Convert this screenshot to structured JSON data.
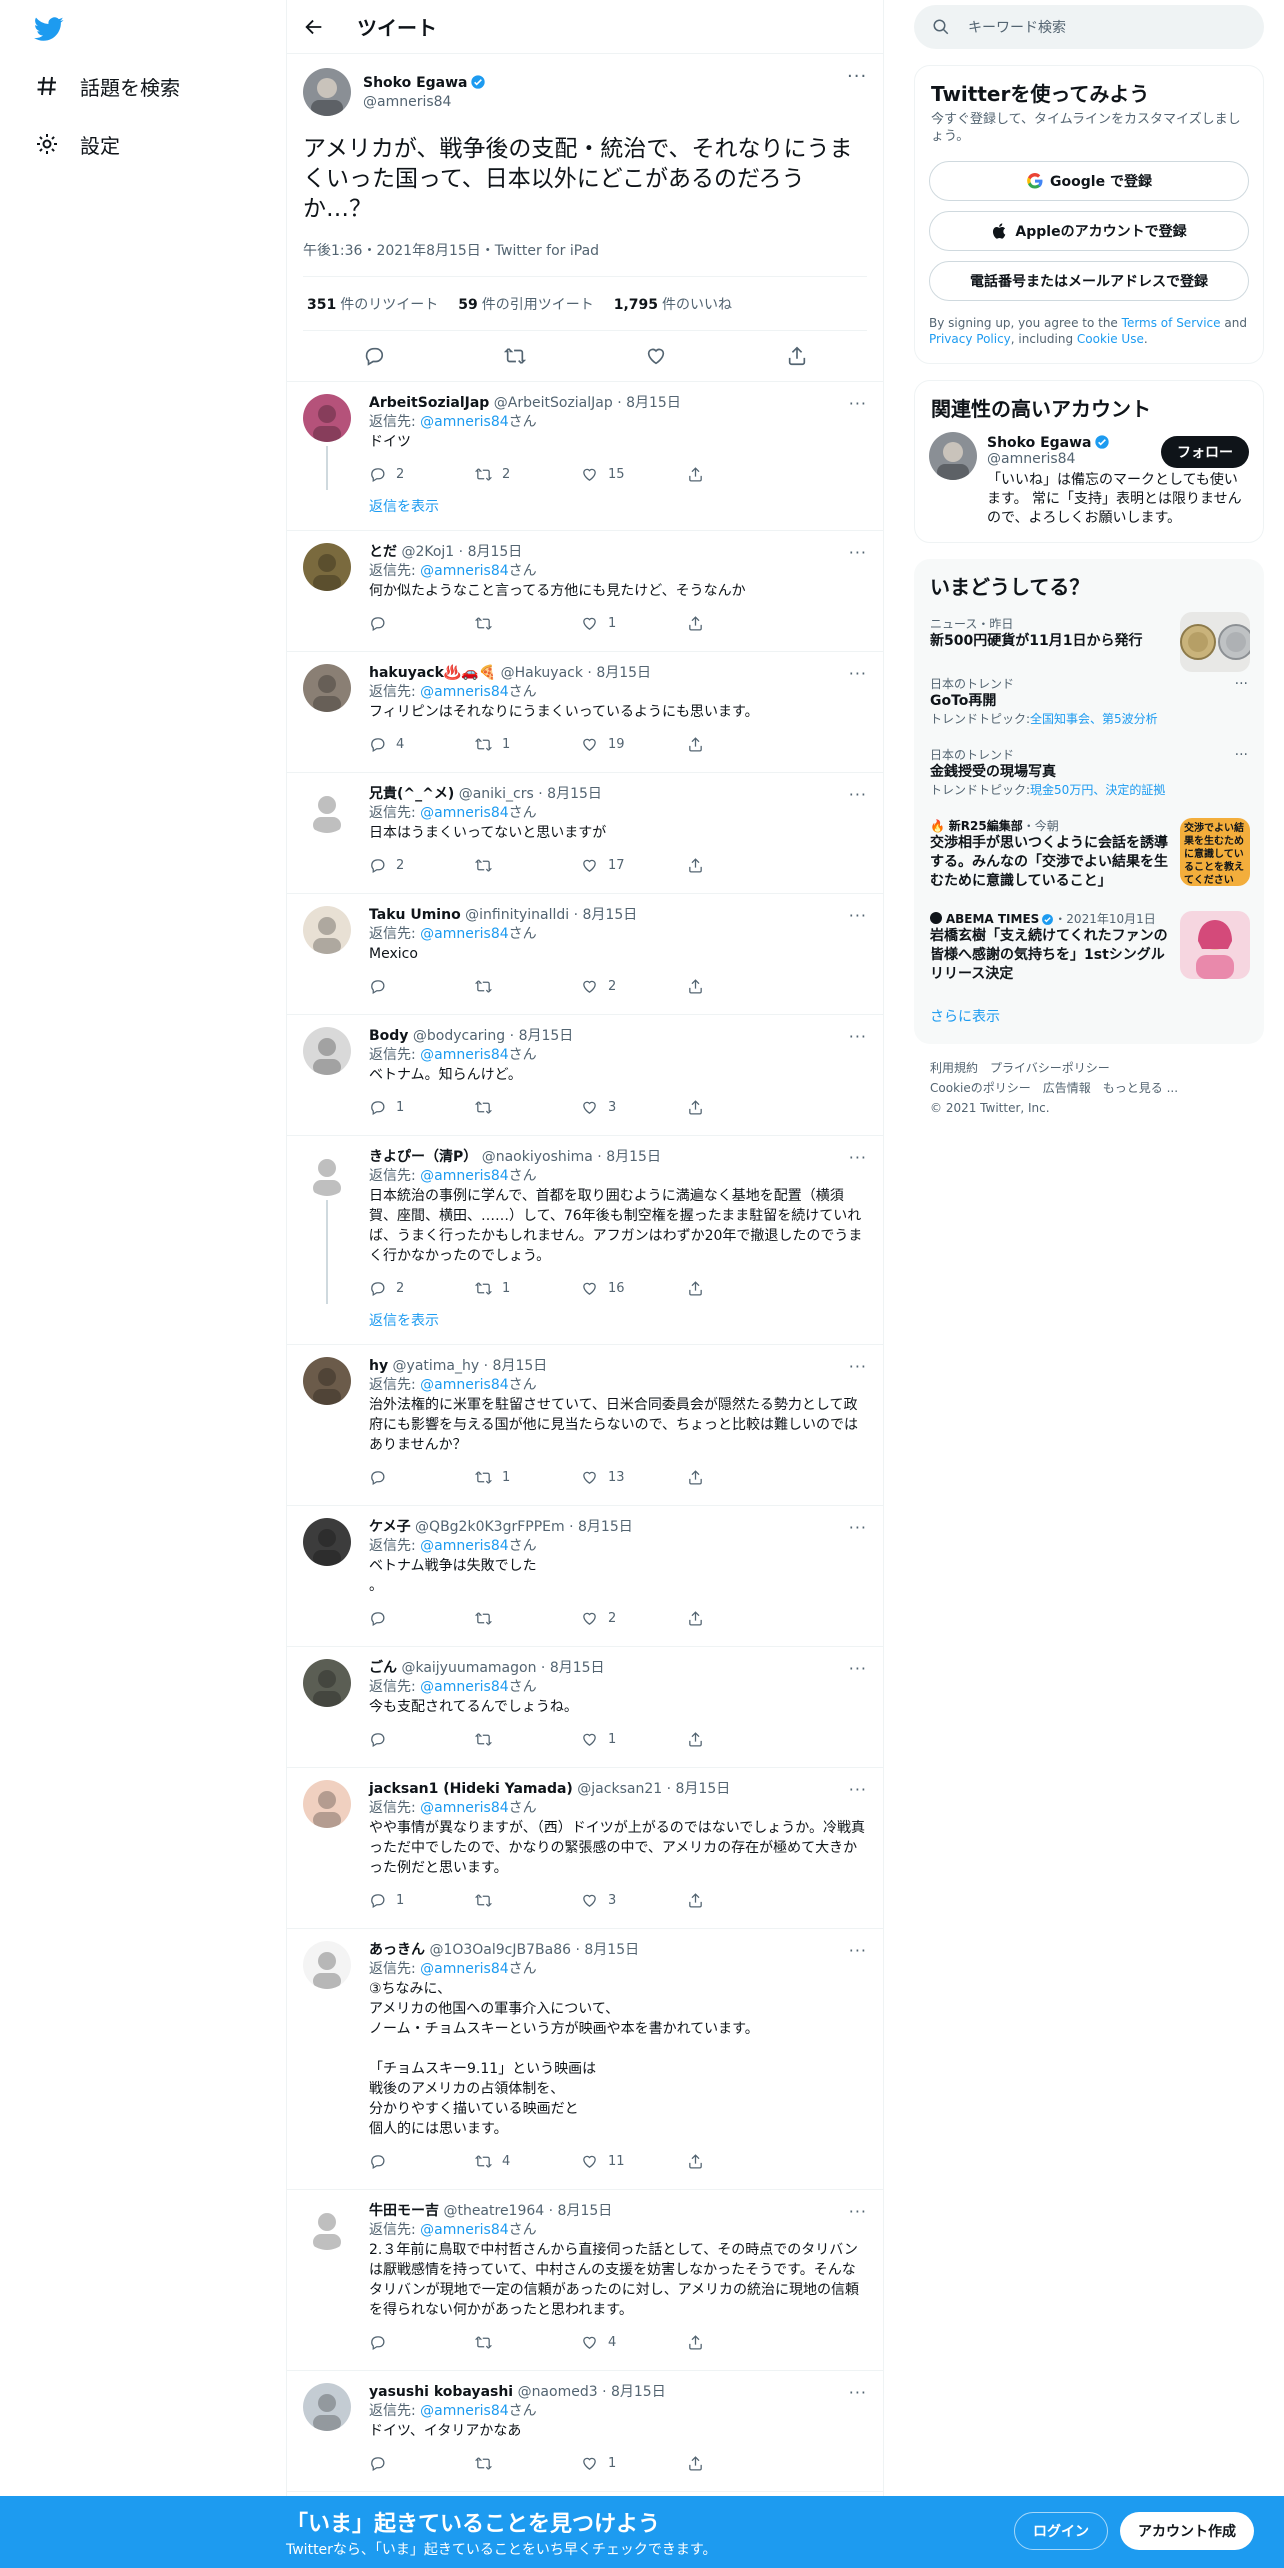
{
  "nav": {
    "explore_label": "話題を検索",
    "settings_label": "設定"
  },
  "header": {
    "title": "ツイート"
  },
  "main_tweet": {
    "display_name": "Shoko Egawa",
    "username": "@amneris84",
    "text": "アメリカが、戦争後の支配・統治で、それなりにうまくいった国って、日本以外にどこがあるのだろうか…？",
    "meta": "午後1:36・2021年8月15日・Twitter for iPad",
    "retweets_count": "351",
    "retweets_label": "件のリツイート",
    "quotes_count": "59",
    "quotes_label": "件の引用ツイート",
    "likes_count": "1,795",
    "likes_label": "件のいいね"
  },
  "replies": [
    {
      "name": "ArbeitSozialJap",
      "handle": "@ArbeitSozialJap",
      "date": "8月15日",
      "to": "@amneris84",
      "text": "ドイツ",
      "reply": "2",
      "rt": "2",
      "like": "15",
      "show_replies": "返信を表示"
    },
    {
      "name": "とだ",
      "handle": "@2Koj1",
      "date": "8月15日",
      "to": "@amneris84",
      "text": "何か似たようなこと言ってる方他にも見たけど、そうなんか",
      "reply": "",
      "rt": "",
      "like": "1"
    },
    {
      "name": "hakuyack♨️🚗🍕",
      "handle": "@Hakuyack",
      "date": "8月15日",
      "to": "@amneris84",
      "text": "フィリピンはそれなりにうまくいっているようにも思います。",
      "reply": "4",
      "rt": "1",
      "like": "19"
    },
    {
      "name": "兄貴(^_^メ)",
      "handle": "@aniki_crs",
      "date": "8月15日",
      "to": "@amneris84",
      "text": "日本はうまくいってないと思いますが",
      "reply": "2",
      "rt": "",
      "like": "17"
    },
    {
      "name": "Taku Umino",
      "handle": "@infinityinalldi",
      "date": "8月15日",
      "to": "@amneris84",
      "text": "Mexico",
      "reply": "",
      "rt": "",
      "like": "2"
    },
    {
      "name": "Body",
      "handle": "@bodycaring",
      "date": "8月15日",
      "to": "@amneris84",
      "text": "ベトナム。知らんけど。",
      "reply": "1",
      "rt": "",
      "like": "3"
    },
    {
      "name": "きよぴー（清P）",
      "handle": "@naokiyoshima",
      "date": "8月15日",
      "to": "@amneris84",
      "text": "日本統治の事例に学んで、首都を取り囲むように満遍なく基地を配置（横須賀、座間、横田、……）して、76年後も制空権を握ったまま駐留を続けていれば、うまく行ったかもしれません。アフガンはわずか20年で撤退したのでうまく行かなかったのでしょう。",
      "reply": "2",
      "rt": "1",
      "like": "16",
      "show_replies": "返信を表示"
    },
    {
      "name": "hy",
      "handle": "@yatima_hy",
      "date": "8月15日",
      "to": "@amneris84",
      "text": "治外法権的に米軍を駐留させていて、日米合同委員会が隠然たる勢力として政府にも影響を与える国が他に見当たらないので、ちょっと比較は難しいのではありませんか？",
      "reply": "",
      "rt": "1",
      "like": "13"
    },
    {
      "name": "ケメ子",
      "handle": "@QBg2k0K3grFPPEm",
      "date": "8月15日",
      "to": "@amneris84",
      "text": "ベトナム戦争は失敗でした\n。",
      "reply": "",
      "rt": "",
      "like": "2"
    },
    {
      "name": "ごん",
      "handle": "@kaijyuumamagon",
      "date": "8月15日",
      "to": "@amneris84",
      "text": "今も支配されてるんでしょうね。",
      "reply": "",
      "rt": "",
      "like": "1"
    },
    {
      "name": "jacksan1 (Hideki Yamada)",
      "handle": "@jacksan21",
      "date": "8月15日",
      "to": "@amneris84",
      "text": "やや事情が異なりますが、（西）ドイツが上がるのではないでしょうか。冷戦真っただ中でしたので、かなりの緊張感の中で、アメリカの存在が極めて大きかった例だと思います。",
      "reply": "1",
      "rt": "",
      "like": "3"
    },
    {
      "name": "あっきん",
      "handle": "@1O3Oal9cJB7Ba86",
      "date": "8月15日",
      "to": "@amneris84",
      "text": "③ちなみに、\nアメリカの他国への軍事介入について、\nノーム・チョムスキーという方が映画や本を書かれています。\n\n「チョムスキー9.11」という映画は\n戦後のアメリカの占領体制を、\n分かりやすく描いている映画だと\n個人的には思います。",
      "reply": "",
      "rt": "4",
      "like": "11"
    },
    {
      "name": "牛田モー吉",
      "handle": "@theatre1964",
      "date": "8月15日",
      "to": "@amneris84",
      "text": "2.３年前に鳥取で中村哲さんから直接伺った話として、その時点でのタリバンは厭戦感情を持っていて、中村さんの支援を妨害しなかったそうです。そんなタリバンが現地で一定の信頼があったのに対し、アメリカの統治に現地の信頼を得られない何かがあったと思われます。",
      "reply": "",
      "rt": "",
      "like": "4"
    },
    {
      "name": "yasushi kobayashi",
      "handle": "@naomed3",
      "date": "8月15日",
      "to": "@amneris84",
      "text": "ドイツ、イタリアかなあ",
      "reply": "",
      "rt": "",
      "like": "1"
    }
  ],
  "reply_prefix": "返信先:",
  "reply_suffix": "さん",
  "search": {
    "placeholder": "キーワード検索"
  },
  "signup": {
    "title": "Twitterを使ってみよう",
    "subtitle": "今すぐ登録して、タイムラインをカスタマイズしましょう。",
    "google": "Google で登録",
    "apple": "Appleのアカウントで登録",
    "phone": "電話番号またはメールアドレスで登録",
    "terms_pre": "By signing up, you agree to the",
    "terms_link": "Terms of Service",
    "terms_and": "and",
    "privacy_link": "Privacy Policy",
    "terms_including": ", including",
    "cookie_link": "Cookie Use",
    "terms_end": "."
  },
  "related": {
    "title": "関連性の高いアカウント",
    "name": "Shoko Egawa",
    "handle": "@amneris84",
    "bio": "「いいね」は備忘のマークとしても使います。 常に「支持」表明とは限りませんので、よろしくお願いします。",
    "follow": "フォロー"
  },
  "trends": {
    "title": "いまどうしてる？",
    "items": [
      {
        "cat": "ニュース・昨日",
        "title": "新500円硬貨が11月1日から発行",
        "sub": ""
      },
      {
        "cat": "日本のトレンド",
        "title": "GoTo再開",
        "sub_label": "トレンドトピック:",
        "sub_link": "全国知事会、第5波分析"
      },
      {
        "cat": "日本のトレンド",
        "title": "金銭授受の現場写真",
        "sub_label": "トレンドトピック:",
        "sub_link": "現金50万円、決定的証拠"
      },
      {
        "cat": "新R25編集部",
        "cat2": "・今朝",
        "title": "交渉相手が思いつくように会話を誘導する。みんなの「交渉でよい結果を生むために意識していること」"
      },
      {
        "cat": "ABEMA TIMES",
        "cat2": "・2021年10月1日",
        "title": "岩橋玄樹「支え続けてくれたファンの皆様へ感謝の気持ちを」1stシングルリリース決定"
      }
    ],
    "show_more": "さらに表示",
    "thumb_text": "交渉でよい結果を生むために意識していることを教えてください"
  },
  "footer": {
    "links": [
      "利用規約",
      "プライバシーポリシー",
      "Cookieのポリシー",
      "広告情報",
      "もっと見る ..."
    ],
    "copyright": "© 2021 Twitter, Inc."
  },
  "bottom": {
    "title": "「いま」起きていることを見つけよう",
    "subtitle": "Twitterなら、「いま」起きていることをいち早くチェックできます。",
    "login": "ログイン",
    "signup": "アカウント作成"
  },
  "colors": {
    "accent": "#1d9bf0",
    "text": "#0f1419",
    "muted": "#536471"
  }
}
